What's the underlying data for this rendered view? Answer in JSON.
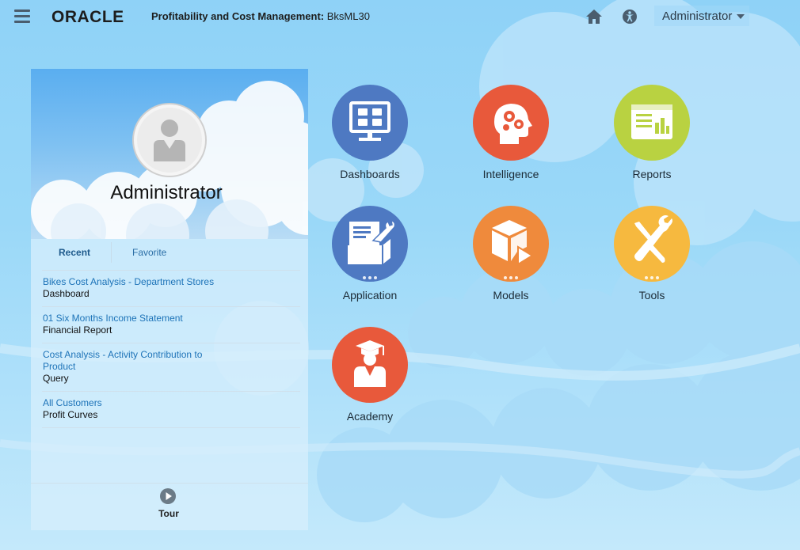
{
  "header": {
    "logo_text": "ORACLE",
    "app_name": "Profitability and Cost Management:",
    "app_instance": "BksML30",
    "user_menu_label": "Administrator"
  },
  "panel": {
    "user_name": "Administrator",
    "tabs": {
      "recent": "Recent",
      "favorite": "Favorite"
    },
    "recent_items": [
      {
        "title": "Bikes Cost Analysis - Department Stores",
        "type": "Dashboard"
      },
      {
        "title": "01 Six Months Income Statement",
        "type": "Financial Report"
      },
      {
        "title": "Cost Analysis - Activity Contribution to Product",
        "type": "Query"
      },
      {
        "title": "All Customers",
        "type": "Profit Curves"
      }
    ],
    "tour_label": "Tour"
  },
  "tiles": [
    {
      "label": "Dashboards",
      "icon": "dashboard-monitor-icon",
      "color": "#4e79c2"
    },
    {
      "label": "Intelligence",
      "icon": "head-gears-icon",
      "color": "#e8593b"
    },
    {
      "label": "Reports",
      "icon": "report-chart-icon",
      "color": "#b9d241"
    },
    {
      "label": "Application",
      "icon": "form-wrench-icon",
      "color": "#4e79c2"
    },
    {
      "label": "Models",
      "icon": "cube-play-icon",
      "color": "#ef8a3c"
    },
    {
      "label": "Tools",
      "icon": "wrench-screwdriver-icon",
      "color": "#f6b93f"
    },
    {
      "label": "Academy",
      "icon": "graduate-icon",
      "color": "#e8593b"
    }
  ]
}
